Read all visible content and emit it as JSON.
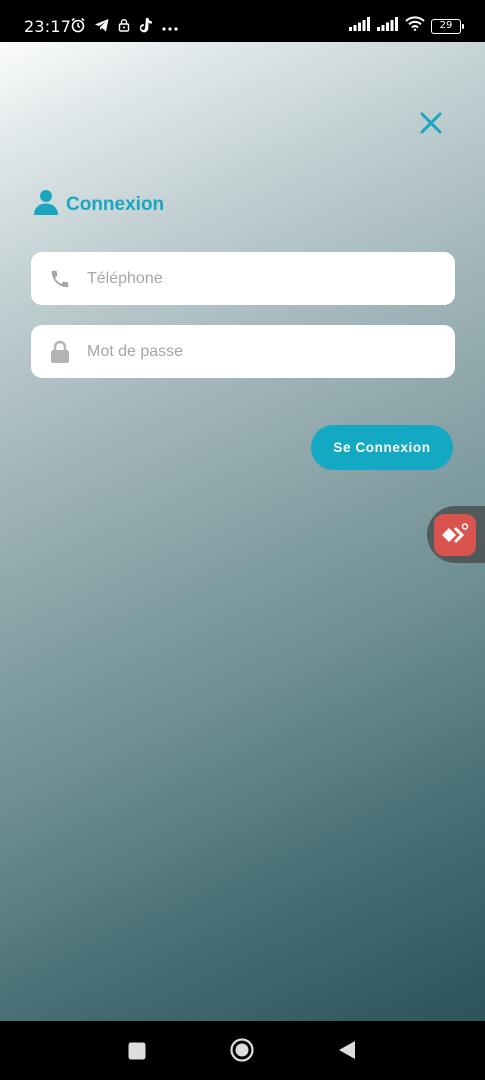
{
  "status_bar": {
    "time": "23:17",
    "battery_level": "29",
    "icons": [
      "alarm-icon",
      "telegram-icon",
      "lock-icon",
      "tiktok-icon",
      "more-icon",
      "signal-icon",
      "signal-icon",
      "wifi-icon",
      "battery-icon"
    ]
  },
  "login": {
    "title": "Connexion",
    "phone_placeholder": "Téléphone",
    "phone_value": "",
    "password_placeholder": "Mot de passe",
    "password_value": "",
    "submit_label": "Se Connexion"
  },
  "colors": {
    "accent": "#14a9c2",
    "title": "#1aa6bf",
    "input_bg": "#ffffff",
    "placeholder": "#a6a6a6"
  },
  "nav": {
    "icons": [
      "recents-square-icon",
      "home-circle-icon",
      "back-triangle-icon"
    ]
  }
}
